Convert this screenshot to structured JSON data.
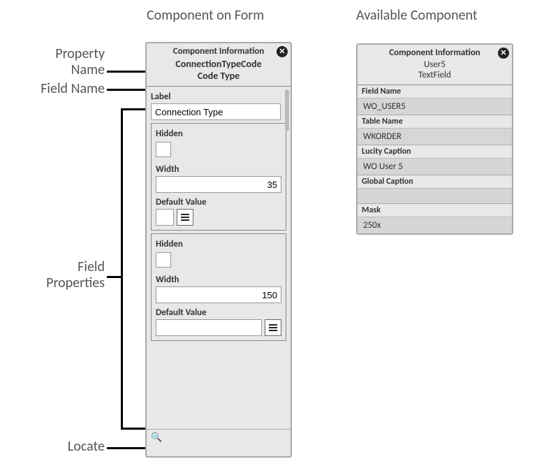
{
  "headings": {
    "component_on_form": "Component on Form",
    "available_component": "Available Component"
  },
  "annotations": {
    "property_name_line1": "Property",
    "property_name_line2": "Name",
    "field_name": "Field Name",
    "field_properties_line1": "Field",
    "field_properties_line2": "Properties",
    "locate": "Locate"
  },
  "formPanel": {
    "title": "Component Information",
    "propertyName": "ConnectionTypeCode",
    "fieldName": "Code Type",
    "label_caption": "Label",
    "label_value": "Connection Type",
    "group1": {
      "hidden_caption": "Hidden",
      "width_caption": "Width",
      "width_value": "35",
      "default_caption": "Default Value",
      "default_value": ""
    },
    "group2": {
      "hidden_caption": "Hidden",
      "width_caption": "Width",
      "width_value": "150",
      "default_caption": "Default Value",
      "default_value": ""
    },
    "locate_placeholder": ""
  },
  "availPanel": {
    "title": "Component Information",
    "componentName": "User5",
    "componentType": "TextField",
    "rows": {
      "field_name_label": "Field Name",
      "field_name_value": "WO_USER5",
      "table_name_label": "Table Name",
      "table_name_value": "WKORDER",
      "lucity_caption_label": "Lucity Caption",
      "lucity_caption_value": "WO User 5",
      "global_caption_label": "Global Caption",
      "global_caption_value": "",
      "mask_label": "Mask",
      "mask_value": "250x"
    }
  }
}
